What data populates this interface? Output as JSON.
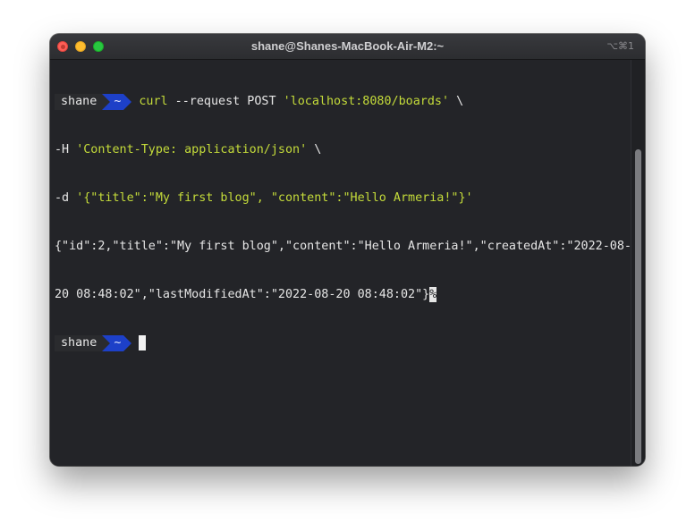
{
  "window": {
    "title": "shane@Shanes-MacBook-Air-M2:~",
    "shortcut": "⌥⌘1"
  },
  "prompt": {
    "user": "shane",
    "dir": "~"
  },
  "terminal": {
    "command_name": "curl",
    "command_args": " --request POST ",
    "url": "'localhost:8080/boards'",
    "line1_cont": " \\",
    "header_flag": "-H ",
    "header_value": "'Content-Type: application/json'",
    "line2_cont": " \\",
    "data_flag": "-d ",
    "data_value": "'{\"title\":\"My first blog\", \"content\":\"Hello Armeria!\"}'",
    "response_line1": "{\"id\":2,\"title\":\"My first blog\",\"content\":\"Hello Armeria!\",\"createdAt\":\"2022-08-",
    "response_line2": "20 08:48:02\",\"lastModifiedAt\":\"2022-08-20 08:48:02\"}",
    "no_newline_marker": "%"
  },
  "colors": {
    "background": "#232428",
    "command": "#c4db3a",
    "prompt_dir_bg": "#1d40c8",
    "close": "#fe5f57",
    "minimize": "#febc2e",
    "maximize": "#28c840"
  }
}
